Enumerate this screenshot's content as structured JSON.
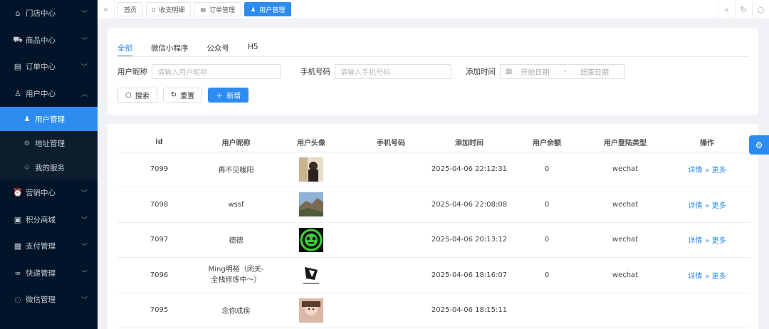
{
  "sidebar": {
    "items": [
      {
        "label": "门店中心",
        "icon": "home-icon"
      },
      {
        "label": "商品中心",
        "icon": "cart-icon"
      },
      {
        "label": "订单中心",
        "icon": "clipboard-icon"
      },
      {
        "label": "用户中心",
        "icon": "user-icon",
        "expanded": true
      },
      {
        "label": "营销中心",
        "icon": "alarm-icon"
      },
      {
        "label": "积分商城",
        "icon": "clipboard-check-icon"
      },
      {
        "label": "支付管理",
        "icon": "calculator-icon"
      },
      {
        "label": "快递管理",
        "icon": "bicycle-icon"
      },
      {
        "label": "微信管理",
        "icon": "chat-icon"
      }
    ],
    "user_center_sub": [
      {
        "label": "用户管理",
        "icon": "user-icon",
        "active": true
      },
      {
        "label": "地址管理",
        "icon": "location-icon"
      },
      {
        "label": "我的服务",
        "icon": "service-icon"
      }
    ]
  },
  "tabs": [
    {
      "label": "首页",
      "icon": ""
    },
    {
      "label": "收支明细",
      "icon": "document-icon"
    },
    {
      "label": "订单管理",
      "icon": "list-icon"
    },
    {
      "label": "用户管理",
      "icon": "user-icon",
      "active": true
    }
  ],
  "filter_tabs": [
    "全部",
    "微信小程序",
    "公众号",
    "H5"
  ],
  "filters": {
    "nickname_label": "用户昵称",
    "nickname_placeholder": "请输入用户昵称",
    "phone_label": "手机号码",
    "phone_placeholder": "请输入手机号码",
    "date_label": "添加时间",
    "date_start": "开始日期",
    "date_sep": "-",
    "date_end": "结束日期"
  },
  "buttons": {
    "search": "搜索",
    "reset": "重置",
    "add": "新增"
  },
  "table": {
    "columns": [
      "id",
      "用户昵称",
      "用户头像",
      "手机号码",
      "添加时间",
      "用户余额",
      "用户登陆类型",
      "操作"
    ],
    "rows": [
      {
        "id": "7099",
        "nickname": "再不见暖阳",
        "phone": "",
        "time": "2025-04-06 22:12:31",
        "balance": "0",
        "login_type": "wechat",
        "detail": "详情",
        "more": "更多"
      },
      {
        "id": "7098",
        "nickname": "wssf",
        "phone": "",
        "time": "2025-04-06 22:08:08",
        "balance": "0",
        "login_type": "wechat",
        "detail": "详情",
        "more": "更多"
      },
      {
        "id": "7097",
        "nickname": "德德",
        "phone": "",
        "time": "2025-04-06 20:13:12",
        "balance": "0",
        "login_type": "wechat",
        "detail": "详情",
        "more": "更多"
      },
      {
        "id": "7096",
        "nickname": "Ming明裕（闭关-全栈修炼中～）",
        "phone": "",
        "time": "2025-04-06 18:16:07",
        "balance": "0",
        "login_type": "wechat",
        "detail": "详情",
        "more": "更多"
      },
      {
        "id": "7095",
        "nickname": "念你成疾",
        "phone": "",
        "time": "2025-04-06 18:15:11",
        "balance": "",
        "login_type": "",
        "detail": "",
        "more": ""
      }
    ]
  },
  "colors": {
    "primary": "#2d8cf0",
    "sidebar_bg": "#001529"
  }
}
